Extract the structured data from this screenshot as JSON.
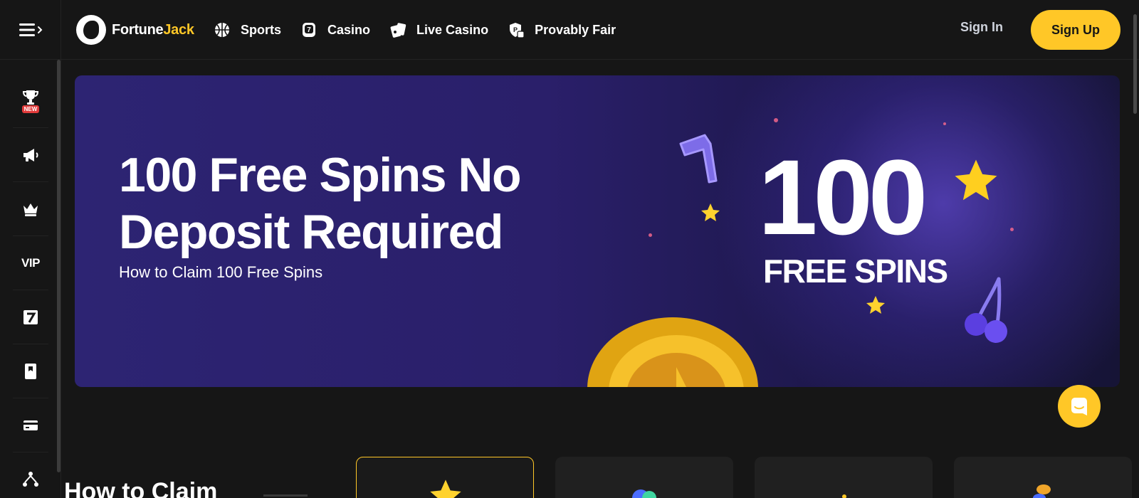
{
  "brand": {
    "name_part1": "Fortune",
    "name_part2": "Jack",
    "accent_color": "#ffc727"
  },
  "nav": [
    {
      "label": "Sports",
      "icon": "basketball-icon"
    },
    {
      "label": "Casino",
      "icon": "slot-seven-icon"
    },
    {
      "label": "Live Casino",
      "icon": "cards-icon"
    },
    {
      "label": "Provably Fair",
      "icon": "shield-dice-icon"
    }
  ],
  "auth": {
    "signin_label": "Sign In",
    "signup_label": "Sign Up"
  },
  "sidebar": {
    "items": [
      {
        "icon": "trophy-icon",
        "badge": "NEW"
      },
      {
        "icon": "megaphone-icon"
      },
      {
        "icon": "crown-icon"
      },
      {
        "icon": "vip-icon",
        "label": "VIP"
      },
      {
        "icon": "seven-tile-icon"
      },
      {
        "icon": "card-icon"
      },
      {
        "icon": "wallet-icon"
      },
      {
        "icon": "network-icon"
      }
    ]
  },
  "hero": {
    "title": "100 Free Spins No Deposit Required",
    "subtitle": "How to Claim 100 Free Spins",
    "graphic_number": "100",
    "graphic_text": "FREE SPINS"
  },
  "section": {
    "title": "How to Claim"
  },
  "cards": [
    {
      "icon": "star-icon",
      "active": true
    },
    {
      "icon": "coins-icon",
      "active": false
    },
    {
      "icon": "sparkle-icon",
      "active": false
    },
    {
      "icon": "coin-stack-icon",
      "active": false
    }
  ],
  "chat": {
    "icon": "chat-icon"
  }
}
